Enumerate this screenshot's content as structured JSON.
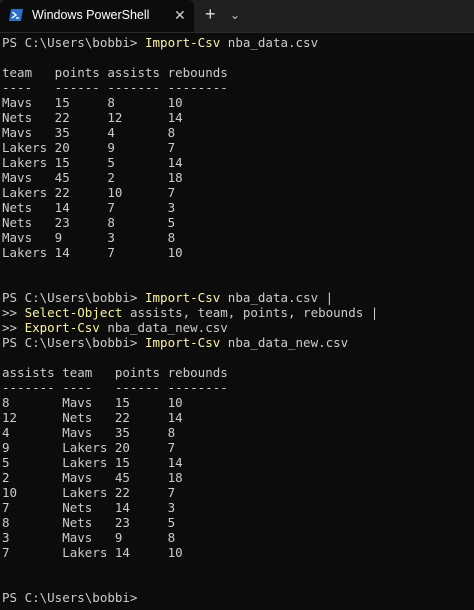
{
  "window": {
    "tab_title": "Windows PowerShell",
    "tab_icon": "powershell-icon",
    "close_glyph": "✕",
    "new_tab_glyph": "+",
    "dropdown_glyph": "⌄"
  },
  "colors": {
    "background": "#0c0c0c",
    "text": "#cccccc",
    "command": "#f9f1a5",
    "parameter": "#9a9a9a",
    "titlebar": "#202020"
  },
  "session": {
    "cmd1": {
      "prompt": "PS C:\\Users\\bobbi> ",
      "command": "Import-Csv",
      "args": " nba_data.csv"
    },
    "table1": {
      "header": "team   points assists rebounds",
      "underline": "----   ------ ------- --------",
      "rows": [
        "Mavs   15     8       10",
        "Nets   22     12      14",
        "Mavs   35     4       8",
        "Lakers 20     9       7",
        "Lakers 15     5       14",
        "Mavs   45     2       18",
        "Lakers 22     10      7",
        "Nets   14     7       3",
        "Nets   23     8       5",
        "Mavs   9      3       8",
        "Lakers 14     7       10"
      ]
    },
    "cmd2": {
      "prompt": "PS C:\\Users\\bobbi> ",
      "command": "Import-Csv",
      "args": " nba_data.csv |",
      "cont_prompt": ">> ",
      "line2_command": "Select-Object",
      "line2_args": " assists, team, points, rebounds |",
      "line3_command": "Export-Csv",
      "line3_args": " nba_data_new.csv"
    },
    "cmd3": {
      "prompt": "PS C:\\Users\\bobbi> ",
      "command": "Import-Csv",
      "args": " nba_data_new.csv"
    },
    "table2": {
      "header": "assists team   points rebounds",
      "underline": "------- ----   ------ --------",
      "rows": [
        "8       Mavs   15     10",
        "12      Nets   22     14",
        "4       Mavs   35     8",
        "9       Lakers 20     7",
        "5       Lakers 15     14",
        "2       Mavs   45     18",
        "10      Lakers 22     7",
        "7       Nets   14     3",
        "8       Nets   23     5",
        "3       Mavs   9      8",
        "7       Lakers 14     10"
      ]
    },
    "final_prompt": "PS C:\\Users\\bobbi>"
  }
}
